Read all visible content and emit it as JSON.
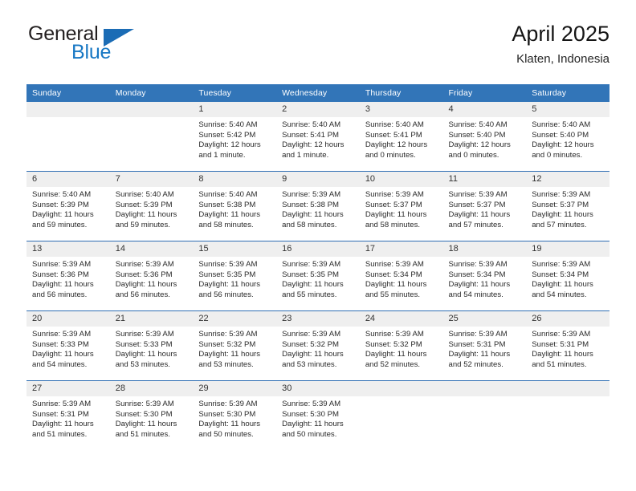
{
  "brand": {
    "name_part1": "General",
    "name_part2": "Blue",
    "flag_icon": "blue-triangle-flag"
  },
  "header": {
    "title": "April 2025",
    "subtitle": "Klaten, Indonesia"
  },
  "colors": {
    "header_blue": "#3275b8",
    "row_rule_blue": "#2f6eb3",
    "daynum_band": "#efefef",
    "brand_blue": "#1878c4",
    "text": "#2a2a2a"
  },
  "calendar": {
    "weekday_headers": [
      "Sunday",
      "Monday",
      "Tuesday",
      "Wednesday",
      "Thursday",
      "Friday",
      "Saturday"
    ],
    "weeks": [
      [
        {
          "day": "",
          "blank": true,
          "sunrise": "",
          "sunset": "",
          "daylight_1": "",
          "daylight_2": ""
        },
        {
          "day": "",
          "blank": true,
          "sunrise": "",
          "sunset": "",
          "daylight_1": "",
          "daylight_2": ""
        },
        {
          "day": "1",
          "blank": false,
          "sunrise": "Sunrise: 5:40 AM",
          "sunset": "Sunset: 5:42 PM",
          "daylight_1": "Daylight: 12 hours",
          "daylight_2": "and 1 minute."
        },
        {
          "day": "2",
          "blank": false,
          "sunrise": "Sunrise: 5:40 AM",
          "sunset": "Sunset: 5:41 PM",
          "daylight_1": "Daylight: 12 hours",
          "daylight_2": "and 1 minute."
        },
        {
          "day": "3",
          "blank": false,
          "sunrise": "Sunrise: 5:40 AM",
          "sunset": "Sunset: 5:41 PM",
          "daylight_1": "Daylight: 12 hours",
          "daylight_2": "and 0 minutes."
        },
        {
          "day": "4",
          "blank": false,
          "sunrise": "Sunrise: 5:40 AM",
          "sunset": "Sunset: 5:40 PM",
          "daylight_1": "Daylight: 12 hours",
          "daylight_2": "and 0 minutes."
        },
        {
          "day": "5",
          "blank": false,
          "sunrise": "Sunrise: 5:40 AM",
          "sunset": "Sunset: 5:40 PM",
          "daylight_1": "Daylight: 12 hours",
          "daylight_2": "and 0 minutes."
        }
      ],
      [
        {
          "day": "6",
          "blank": false,
          "sunrise": "Sunrise: 5:40 AM",
          "sunset": "Sunset: 5:39 PM",
          "daylight_1": "Daylight: 11 hours",
          "daylight_2": "and 59 minutes."
        },
        {
          "day": "7",
          "blank": false,
          "sunrise": "Sunrise: 5:40 AM",
          "sunset": "Sunset: 5:39 PM",
          "daylight_1": "Daylight: 11 hours",
          "daylight_2": "and 59 minutes."
        },
        {
          "day": "8",
          "blank": false,
          "sunrise": "Sunrise: 5:40 AM",
          "sunset": "Sunset: 5:38 PM",
          "daylight_1": "Daylight: 11 hours",
          "daylight_2": "and 58 minutes."
        },
        {
          "day": "9",
          "blank": false,
          "sunrise": "Sunrise: 5:39 AM",
          "sunset": "Sunset: 5:38 PM",
          "daylight_1": "Daylight: 11 hours",
          "daylight_2": "and 58 minutes."
        },
        {
          "day": "10",
          "blank": false,
          "sunrise": "Sunrise: 5:39 AM",
          "sunset": "Sunset: 5:37 PM",
          "daylight_1": "Daylight: 11 hours",
          "daylight_2": "and 58 minutes."
        },
        {
          "day": "11",
          "blank": false,
          "sunrise": "Sunrise: 5:39 AM",
          "sunset": "Sunset: 5:37 PM",
          "daylight_1": "Daylight: 11 hours",
          "daylight_2": "and 57 minutes."
        },
        {
          "day": "12",
          "blank": false,
          "sunrise": "Sunrise: 5:39 AM",
          "sunset": "Sunset: 5:37 PM",
          "daylight_1": "Daylight: 11 hours",
          "daylight_2": "and 57 minutes."
        }
      ],
      [
        {
          "day": "13",
          "blank": false,
          "sunrise": "Sunrise: 5:39 AM",
          "sunset": "Sunset: 5:36 PM",
          "daylight_1": "Daylight: 11 hours",
          "daylight_2": "and 56 minutes."
        },
        {
          "day": "14",
          "blank": false,
          "sunrise": "Sunrise: 5:39 AM",
          "sunset": "Sunset: 5:36 PM",
          "daylight_1": "Daylight: 11 hours",
          "daylight_2": "and 56 minutes."
        },
        {
          "day": "15",
          "blank": false,
          "sunrise": "Sunrise: 5:39 AM",
          "sunset": "Sunset: 5:35 PM",
          "daylight_1": "Daylight: 11 hours",
          "daylight_2": "and 56 minutes."
        },
        {
          "day": "16",
          "blank": false,
          "sunrise": "Sunrise: 5:39 AM",
          "sunset": "Sunset: 5:35 PM",
          "daylight_1": "Daylight: 11 hours",
          "daylight_2": "and 55 minutes."
        },
        {
          "day": "17",
          "blank": false,
          "sunrise": "Sunrise: 5:39 AM",
          "sunset": "Sunset: 5:34 PM",
          "daylight_1": "Daylight: 11 hours",
          "daylight_2": "and 55 minutes."
        },
        {
          "day": "18",
          "blank": false,
          "sunrise": "Sunrise: 5:39 AM",
          "sunset": "Sunset: 5:34 PM",
          "daylight_1": "Daylight: 11 hours",
          "daylight_2": "and 54 minutes."
        },
        {
          "day": "19",
          "blank": false,
          "sunrise": "Sunrise: 5:39 AM",
          "sunset": "Sunset: 5:34 PM",
          "daylight_1": "Daylight: 11 hours",
          "daylight_2": "and 54 minutes."
        }
      ],
      [
        {
          "day": "20",
          "blank": false,
          "sunrise": "Sunrise: 5:39 AM",
          "sunset": "Sunset: 5:33 PM",
          "daylight_1": "Daylight: 11 hours",
          "daylight_2": "and 54 minutes."
        },
        {
          "day": "21",
          "blank": false,
          "sunrise": "Sunrise: 5:39 AM",
          "sunset": "Sunset: 5:33 PM",
          "daylight_1": "Daylight: 11 hours",
          "daylight_2": "and 53 minutes."
        },
        {
          "day": "22",
          "blank": false,
          "sunrise": "Sunrise: 5:39 AM",
          "sunset": "Sunset: 5:32 PM",
          "daylight_1": "Daylight: 11 hours",
          "daylight_2": "and 53 minutes."
        },
        {
          "day": "23",
          "blank": false,
          "sunrise": "Sunrise: 5:39 AM",
          "sunset": "Sunset: 5:32 PM",
          "daylight_1": "Daylight: 11 hours",
          "daylight_2": "and 53 minutes."
        },
        {
          "day": "24",
          "blank": false,
          "sunrise": "Sunrise: 5:39 AM",
          "sunset": "Sunset: 5:32 PM",
          "daylight_1": "Daylight: 11 hours",
          "daylight_2": "and 52 minutes."
        },
        {
          "day": "25",
          "blank": false,
          "sunrise": "Sunrise: 5:39 AM",
          "sunset": "Sunset: 5:31 PM",
          "daylight_1": "Daylight: 11 hours",
          "daylight_2": "and 52 minutes."
        },
        {
          "day": "26",
          "blank": false,
          "sunrise": "Sunrise: 5:39 AM",
          "sunset": "Sunset: 5:31 PM",
          "daylight_1": "Daylight: 11 hours",
          "daylight_2": "and 51 minutes."
        }
      ],
      [
        {
          "day": "27",
          "blank": false,
          "sunrise": "Sunrise: 5:39 AM",
          "sunset": "Sunset: 5:31 PM",
          "daylight_1": "Daylight: 11 hours",
          "daylight_2": "and 51 minutes."
        },
        {
          "day": "28",
          "blank": false,
          "sunrise": "Sunrise: 5:39 AM",
          "sunset": "Sunset: 5:30 PM",
          "daylight_1": "Daylight: 11 hours",
          "daylight_2": "and 51 minutes."
        },
        {
          "day": "29",
          "blank": false,
          "sunrise": "Sunrise: 5:39 AM",
          "sunset": "Sunset: 5:30 PM",
          "daylight_1": "Daylight: 11 hours",
          "daylight_2": "and 50 minutes."
        },
        {
          "day": "30",
          "blank": false,
          "sunrise": "Sunrise: 5:39 AM",
          "sunset": "Sunset: 5:30 PM",
          "daylight_1": "Daylight: 11 hours",
          "daylight_2": "and 50 minutes."
        },
        {
          "day": "",
          "blank": true,
          "sunrise": "",
          "sunset": "",
          "daylight_1": "",
          "daylight_2": ""
        },
        {
          "day": "",
          "blank": true,
          "sunrise": "",
          "sunset": "",
          "daylight_1": "",
          "daylight_2": ""
        },
        {
          "day": "",
          "blank": true,
          "sunrise": "",
          "sunset": "",
          "daylight_1": "",
          "daylight_2": ""
        }
      ]
    ]
  }
}
